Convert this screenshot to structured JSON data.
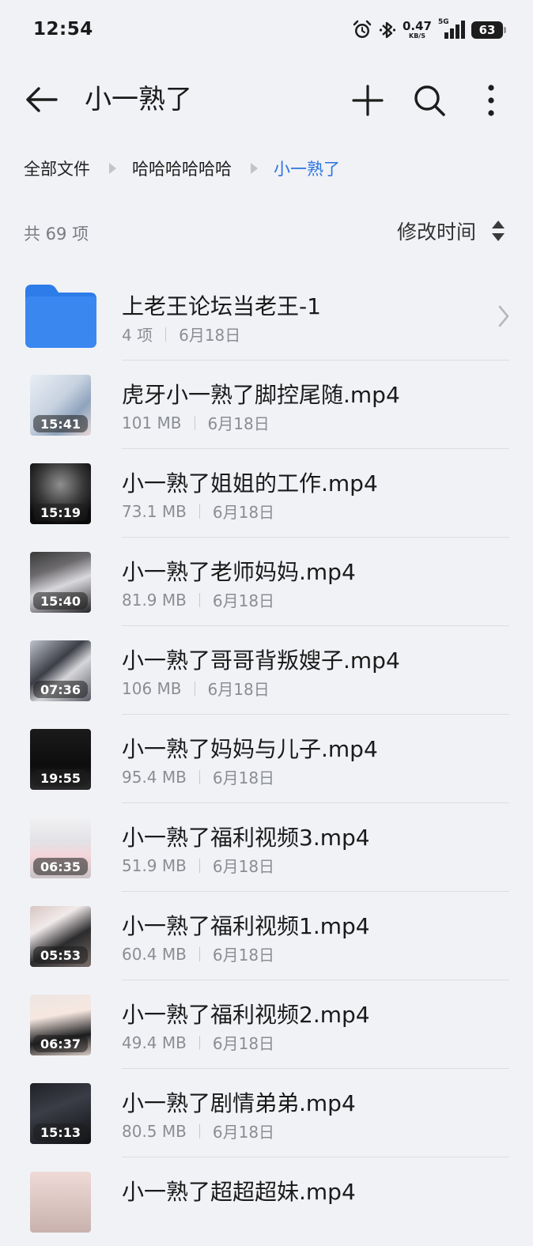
{
  "status_bar": {
    "time": "12:54",
    "net_speed_value": "0.47",
    "net_speed_unit": "KB/S",
    "signal_label": "5G",
    "battery": "63"
  },
  "app_bar": {
    "title": "小一熟了",
    "back_icon": "arrow-left-icon",
    "add_icon": "plus-icon",
    "search_icon": "search-icon",
    "more_icon": "more-vertical-icon"
  },
  "breadcrumb": [
    "全部文件",
    "哈哈哈哈哈哈",
    "小一熟了"
  ],
  "list_header": {
    "count_label": "共 69 项",
    "sort_label": "修改时间"
  },
  "items": [
    {
      "type": "folder",
      "name": "上老王论坛当老王-1",
      "size": "4 项",
      "date": "6月18日"
    },
    {
      "type": "video",
      "name": "虎牙小一熟了脚控尾随.mp4",
      "size": "101 MB",
      "date": "6月18日",
      "duration": "15:41"
    },
    {
      "type": "video",
      "name": "小一熟了姐姐的工作.mp4",
      "size": "73.1 MB",
      "date": "6月18日",
      "duration": "15:19"
    },
    {
      "type": "video",
      "name": "小一熟了老师妈妈.mp4",
      "size": "81.9 MB",
      "date": "6月18日",
      "duration": "15:40"
    },
    {
      "type": "video",
      "name": "小一熟了哥哥背叛嫂子.mp4",
      "size": "106 MB",
      "date": "6月18日",
      "duration": "07:36"
    },
    {
      "type": "video",
      "name": "小一熟了妈妈与儿子.mp4",
      "size": "95.4 MB",
      "date": "6月18日",
      "duration": "19:55"
    },
    {
      "type": "video",
      "name": "小一熟了福利视频3.mp4",
      "size": "51.9 MB",
      "date": "6月18日",
      "duration": "06:35"
    },
    {
      "type": "video",
      "name": "小一熟了福利视频1.mp4",
      "size": "60.4 MB",
      "date": "6月18日",
      "duration": "05:53"
    },
    {
      "type": "video",
      "name": "小一熟了福利视频2.mp4",
      "size": "49.4 MB",
      "date": "6月18日",
      "duration": "06:37"
    },
    {
      "type": "video",
      "name": "小一熟了剧情弟弟.mp4",
      "size": "80.5 MB",
      "date": "6月18日",
      "duration": "15:13"
    },
    {
      "type": "video",
      "name": "小一熟了超超超妹.mp4",
      "size": "",
      "date": "",
      "duration": ""
    }
  ],
  "colors": {
    "accent": "#2b73e0",
    "folder": "#2d7ce9",
    "background": "#f1f2f6"
  }
}
